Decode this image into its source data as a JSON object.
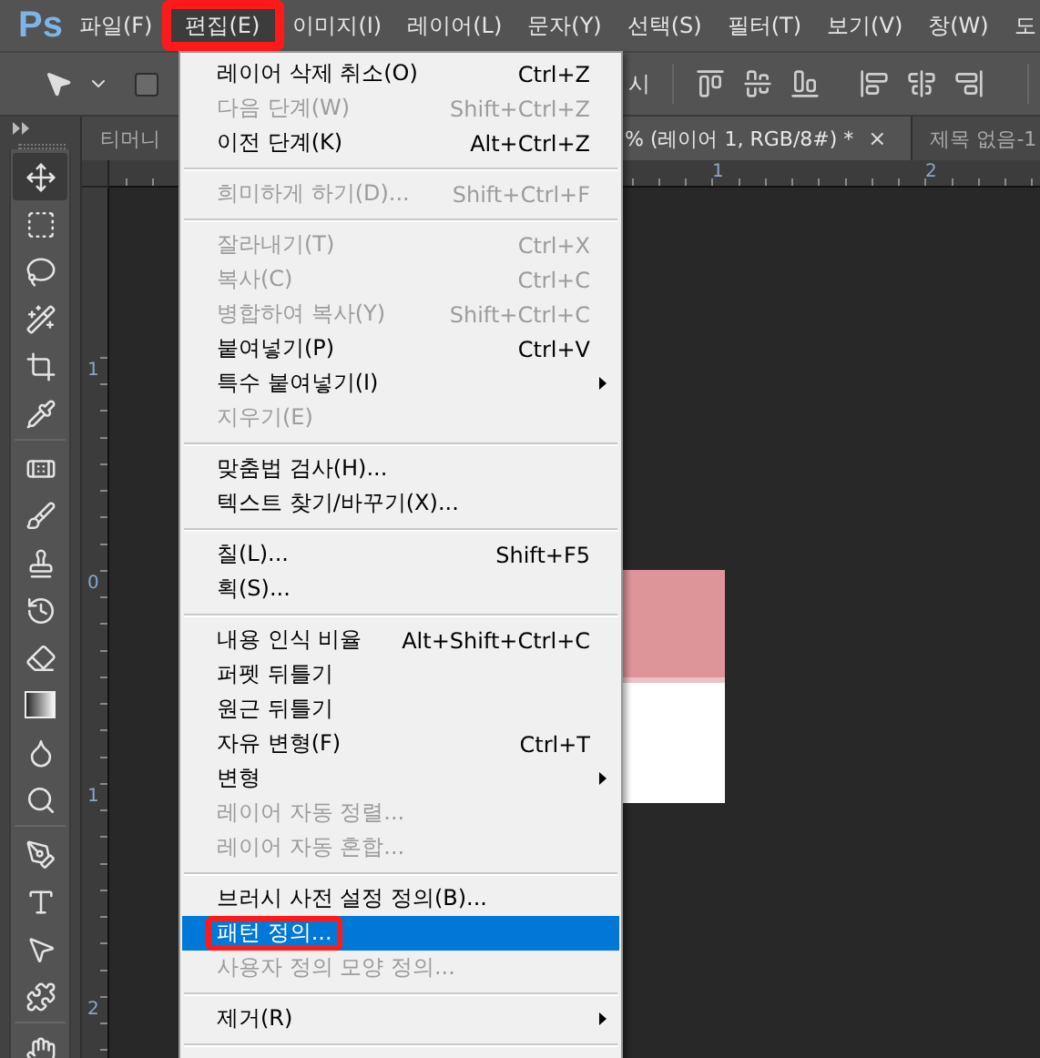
{
  "app_logo": "Ps",
  "menu_bar": [
    {
      "label": "파일(F)",
      "selected": false,
      "annotated": false
    },
    {
      "label": "편집(E)",
      "selected": true,
      "annotated": true
    },
    {
      "label": "이미지(I)",
      "selected": false,
      "annotated": false
    },
    {
      "label": "레이어(L)",
      "selected": false,
      "annotated": false
    },
    {
      "label": "문자(Y)",
      "selected": false,
      "annotated": false
    },
    {
      "label": "선택(S)",
      "selected": false,
      "annotated": false
    },
    {
      "label": "필터(T)",
      "selected": false,
      "annotated": false
    },
    {
      "label": "보기(V)",
      "selected": false,
      "annotated": false
    },
    {
      "label": "창(W)",
      "selected": false,
      "annotated": false
    },
    {
      "label": "도",
      "selected": false,
      "annotated": false
    }
  ],
  "options_bar": {
    "checkbox": {
      "checked": false
    },
    "label_tail": "시"
  },
  "tabs": [
    {
      "label": "티머니",
      "selected": false
    },
    {
      "label": "% (레이어 1, RGB/8#) *",
      "selected": true,
      "close": "×"
    },
    {
      "label": "제목 없음-1",
      "selected": false
    }
  ],
  "horizontal_ruler": [
    "1",
    "2"
  ],
  "vertical_ruler": [
    "1",
    "0",
    "1",
    "2"
  ],
  "tools": [
    {
      "kind": "move",
      "selected": true
    },
    {
      "kind": "marquee",
      "selected": false
    },
    {
      "kind": "lasso",
      "selected": false
    },
    {
      "kind": "wand",
      "selected": false
    },
    {
      "kind": "crop",
      "selected": false
    },
    {
      "kind": "eyedropper",
      "selected": false
    },
    {
      "kind": "separator"
    },
    {
      "kind": "heal",
      "selected": false
    },
    {
      "kind": "brush",
      "selected": false
    },
    {
      "kind": "stamp",
      "selected": false
    },
    {
      "kind": "history",
      "selected": false
    },
    {
      "kind": "eraser",
      "selected": false
    },
    {
      "kind": "gradient",
      "selected": false
    },
    {
      "kind": "blur",
      "selected": false
    },
    {
      "kind": "dodge",
      "selected": false
    },
    {
      "kind": "separator"
    },
    {
      "kind": "pen",
      "selected": false
    },
    {
      "kind": "type",
      "selected": false
    },
    {
      "kind": "path",
      "selected": false
    },
    {
      "kind": "shape",
      "selected": false
    },
    {
      "kind": "separator"
    },
    {
      "kind": "hand",
      "selected": false
    }
  ],
  "edit_menu": {
    "items": [
      {
        "kind": "item",
        "label": "레이어 삭제 취소(O)",
        "shortcut": "Ctrl+Z",
        "disabled": false,
        "submenu": false,
        "selected": false,
        "annotated": false
      },
      {
        "kind": "item",
        "label": "다음 단계(W)",
        "shortcut": "Shift+Ctrl+Z",
        "disabled": true,
        "submenu": false,
        "selected": false,
        "annotated": false
      },
      {
        "kind": "item",
        "label": "이전 단계(K)",
        "shortcut": "Alt+Ctrl+Z",
        "disabled": false,
        "submenu": false,
        "selected": false,
        "annotated": false
      },
      {
        "kind": "separator"
      },
      {
        "kind": "item",
        "label": "희미하게 하기(D)...",
        "shortcut": "Shift+Ctrl+F",
        "disabled": true,
        "submenu": false,
        "selected": false,
        "annotated": false
      },
      {
        "kind": "separator"
      },
      {
        "kind": "item",
        "label": "잘라내기(T)",
        "shortcut": "Ctrl+X",
        "disabled": true,
        "submenu": false,
        "selected": false,
        "annotated": false
      },
      {
        "kind": "item",
        "label": "복사(C)",
        "shortcut": "Ctrl+C",
        "disabled": true,
        "submenu": false,
        "selected": false,
        "annotated": false
      },
      {
        "kind": "item",
        "label": "병합하여 복사(Y)",
        "shortcut": "Shift+Ctrl+C",
        "disabled": true,
        "submenu": false,
        "selected": false,
        "annotated": false
      },
      {
        "kind": "item",
        "label": "붙여넣기(P)",
        "shortcut": "Ctrl+V",
        "disabled": false,
        "submenu": false,
        "selected": false,
        "annotated": false
      },
      {
        "kind": "item",
        "label": "특수 붙여넣기(I)",
        "disabled": false,
        "submenu": true,
        "selected": false,
        "annotated": false
      },
      {
        "kind": "item",
        "label": "지우기(E)",
        "disabled": true,
        "submenu": false,
        "selected": false,
        "annotated": false
      },
      {
        "kind": "separator"
      },
      {
        "kind": "item",
        "label": "맞춤법 검사(H)...",
        "disabled": false,
        "submenu": false,
        "selected": false,
        "annotated": false
      },
      {
        "kind": "item",
        "label": "텍스트 찾기/바꾸기(X)...",
        "disabled": false,
        "submenu": false,
        "selected": false,
        "annotated": false
      },
      {
        "kind": "separator"
      },
      {
        "kind": "item",
        "label": "칠(L)...",
        "shortcut": "Shift+F5",
        "disabled": false,
        "submenu": false,
        "selected": false,
        "annotated": false
      },
      {
        "kind": "item",
        "label": "획(S)...",
        "disabled": false,
        "submenu": false,
        "selected": false,
        "annotated": false
      },
      {
        "kind": "separator"
      },
      {
        "kind": "item",
        "label": "내용 인식 비율",
        "shortcut": "Alt+Shift+Ctrl+C",
        "disabled": false,
        "submenu": false,
        "selected": false,
        "annotated": false
      },
      {
        "kind": "item",
        "label": "퍼펫 뒤틀기",
        "disabled": false,
        "submenu": false,
        "selected": false,
        "annotated": false
      },
      {
        "kind": "item",
        "label": "원근 뒤틀기",
        "disabled": false,
        "submenu": false,
        "selected": false,
        "annotated": false
      },
      {
        "kind": "item",
        "label": "자유 변형(F)",
        "shortcut": "Ctrl+T",
        "disabled": false,
        "submenu": false,
        "selected": false,
        "annotated": false
      },
      {
        "kind": "item",
        "label": "변형",
        "disabled": false,
        "submenu": true,
        "selected": false,
        "annotated": false
      },
      {
        "kind": "item",
        "label": "레이어 자동 정렬...",
        "disabled": true,
        "submenu": false,
        "selected": false,
        "annotated": false
      },
      {
        "kind": "item",
        "label": "레이어 자동 혼합...",
        "disabled": true,
        "submenu": false,
        "selected": false,
        "annotated": false
      },
      {
        "kind": "separator"
      },
      {
        "kind": "item",
        "label": "브러시 사전 설정 정의(B)...",
        "disabled": false,
        "submenu": false,
        "selected": false,
        "annotated": false
      },
      {
        "kind": "item",
        "label": "패턴 정의...",
        "disabled": false,
        "submenu": false,
        "selected": true,
        "annotated": true
      },
      {
        "kind": "item",
        "label": "사용자 정의 모양 정의...",
        "disabled": true,
        "submenu": false,
        "selected": false,
        "annotated": false
      },
      {
        "kind": "separator"
      },
      {
        "kind": "item",
        "label": "제거(R)",
        "disabled": false,
        "submenu": true,
        "selected": false,
        "annotated": false
      },
      {
        "kind": "separator"
      }
    ]
  }
}
